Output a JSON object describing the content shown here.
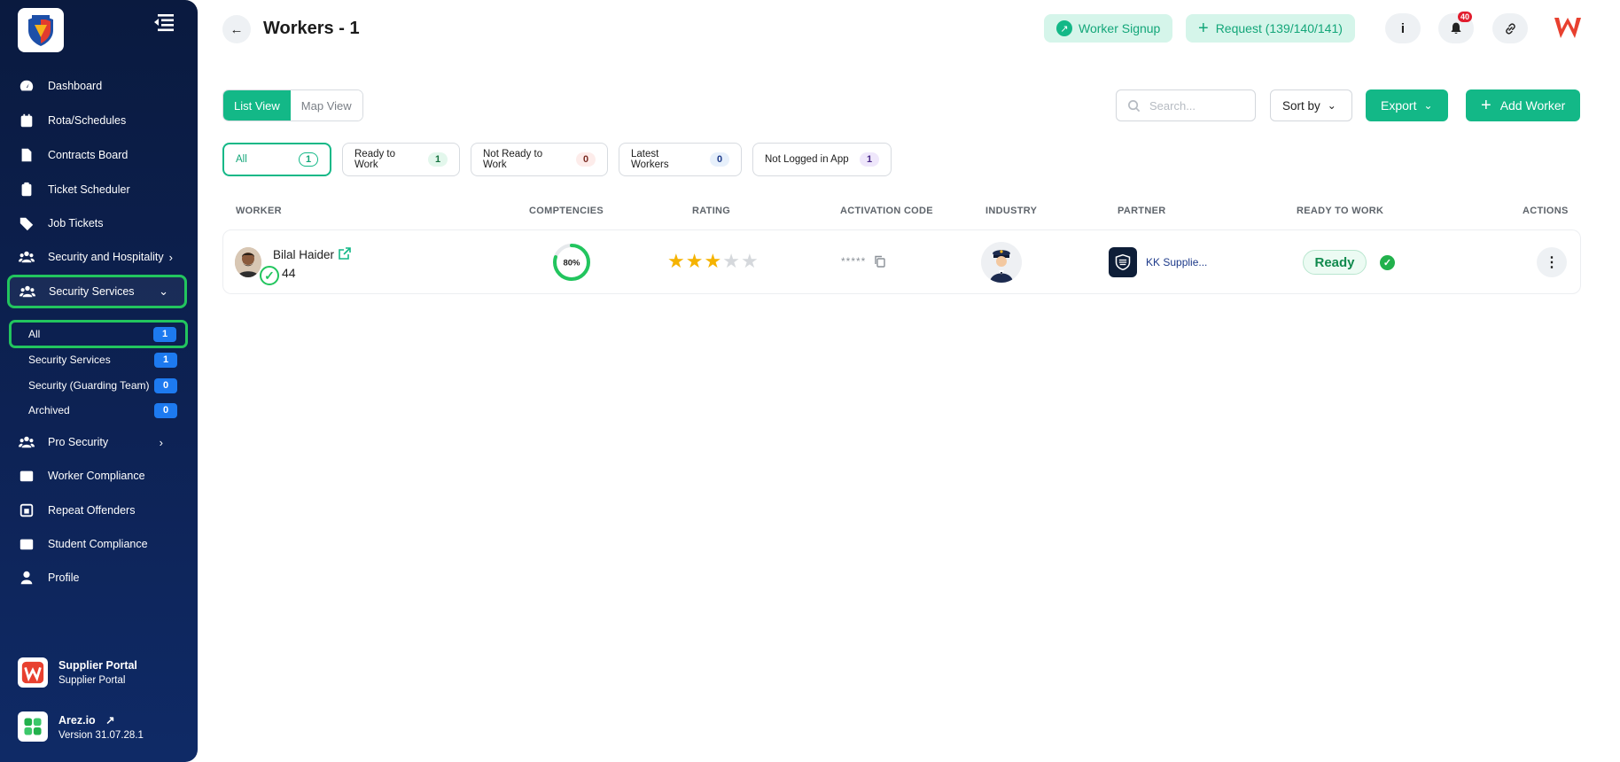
{
  "sidebar": {
    "items": [
      {
        "label": "Dashboard",
        "icon": "dashboard-icon"
      },
      {
        "label": "Rota/Schedules",
        "icon": "calendar-icon"
      },
      {
        "label": "Contracts Board",
        "icon": "document-icon"
      },
      {
        "label": "Ticket Scheduler",
        "icon": "clipboard-icon"
      },
      {
        "label": "Job Tickets",
        "icon": "tag-icon"
      },
      {
        "label": "Security and Hospitality",
        "icon": "users-icon"
      },
      {
        "label": "Security Services",
        "icon": "users-icon"
      },
      {
        "label": "Pro Security",
        "icon": "users-icon"
      },
      {
        "label": "Worker Compliance",
        "icon": "id-card-icon"
      },
      {
        "label": "Repeat Offenders",
        "icon": "repeat-icon"
      },
      {
        "label": "Student Compliance",
        "icon": "id-card-icon"
      },
      {
        "label": "Profile",
        "icon": "user-icon"
      }
    ],
    "subitems": [
      {
        "label": "All",
        "count": "1"
      },
      {
        "label": "Security Services",
        "count": "1"
      },
      {
        "label": "Security (Guarding Team)",
        "count": "0"
      },
      {
        "label": "Archived",
        "count": "0"
      }
    ],
    "footer": {
      "portal_title": "Supplier Portal",
      "portal_sub": "Supplier Portal",
      "app_name": "Arez.io",
      "version": "Version 31.07.28.1"
    }
  },
  "header": {
    "title": "Workers - 1",
    "worker_signup": "Worker Signup",
    "request": "Request (139/140/141)",
    "info": "i",
    "notification_count": "40"
  },
  "toolbar": {
    "list_view": "List View",
    "map_view": "Map View",
    "search_placeholder": "Search...",
    "sort_by": "Sort by",
    "export": "Export",
    "add_worker": "Add Worker"
  },
  "filters": [
    {
      "label": "All",
      "count": "1"
    },
    {
      "label": "Ready to Work",
      "count": "1"
    },
    {
      "label": "Not Ready to Work",
      "count": "0"
    },
    {
      "label": "Latest Workers",
      "count": "0"
    },
    {
      "label": "Not Logged in App",
      "count": "1"
    }
  ],
  "table": {
    "columns": [
      "WORKER",
      "COMPTENCIES",
      "RATING",
      "ACTIVATION CODE",
      "INDUSTRY",
      "PARTNER",
      "READY TO WORK",
      "ACTIONS"
    ],
    "rows": [
      {
        "name": "Bilal Haider",
        "number": "44",
        "competency": "80%",
        "competency_value": 0.8,
        "rating": 3,
        "rating_max": 5,
        "activation_code": "*****",
        "partner": "KK Supplie...",
        "ready": "Ready"
      }
    ]
  },
  "colors": {
    "accent": "#13b887",
    "sidebar": "#0d2254",
    "highlight": "#22c55e",
    "star": "#f5b301"
  }
}
